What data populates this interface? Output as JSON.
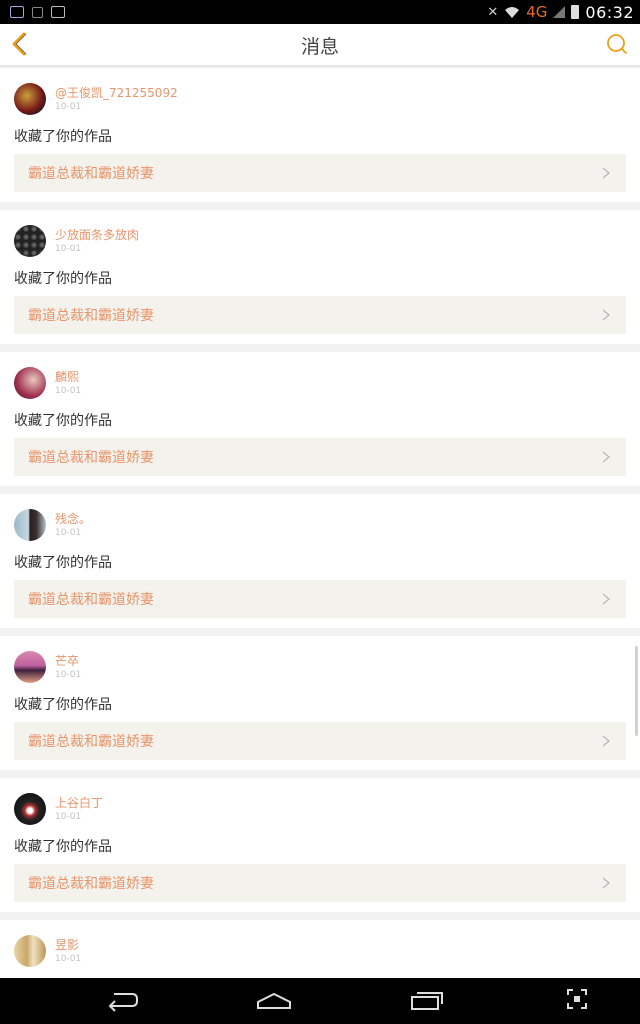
{
  "status_bar": {
    "time": "06:32",
    "network": "4G",
    "icons": [
      "app-icon",
      "lock-icon",
      "image-icon",
      "mute-icon",
      "wifi-icon",
      "signal-icon",
      "battery-icon"
    ]
  },
  "header": {
    "title": "消息",
    "back_icon": "chevron-left-icon",
    "search_icon": "search-icon",
    "accent_color": "#e8a21a"
  },
  "messages": [
    {
      "user": "@王俊凯_721255092",
      "date": "10-01",
      "action": "收藏了你的作品",
      "work": "霸道总裁和霸道娇妻"
    },
    {
      "user": "少放面条多放肉",
      "date": "10-01",
      "action": "收藏了你的作品",
      "work": "霸道总裁和霸道娇妻"
    },
    {
      "user": "麟熙",
      "date": "10-01",
      "action": "收藏了你的作品",
      "work": "霸道总裁和霸道娇妻"
    },
    {
      "user": "残念。",
      "date": "10-01",
      "action": "收藏了你的作品",
      "work": "霸道总裁和霸道娇妻"
    },
    {
      "user": "芒卒",
      "date": "10-01",
      "action": "收藏了你的作品",
      "work": "霸道总裁和霸道娇妻"
    },
    {
      "user": "上谷白丁",
      "date": "10-01",
      "action": "收藏了你的作品",
      "work": "霸道总裁和霸道娇妻"
    },
    {
      "user": "昱影",
      "date": "10-01",
      "action": "",
      "work": ""
    }
  ],
  "nav_bar": {
    "icons": [
      "back-nav-icon",
      "home-nav-icon",
      "recents-nav-icon",
      "screenshot-nav-icon"
    ]
  },
  "colors": {
    "username": "#e8956b",
    "work_link_bg": "#f3f2ec",
    "date": "#c2c2c2"
  }
}
